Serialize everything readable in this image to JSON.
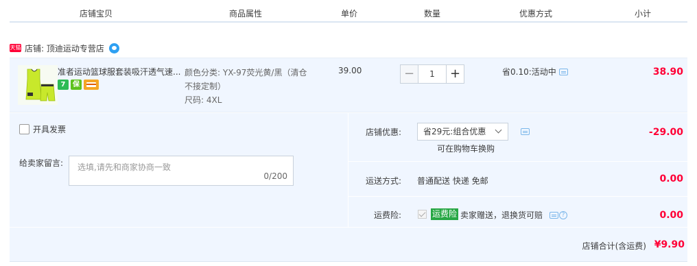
{
  "header": {
    "col_shop_item": "店铺宝贝",
    "col_attributes": "商品属性",
    "col_unit_price": "单价",
    "col_quantity": "数量",
    "col_discount": "优惠方式",
    "col_subtotal": "小计"
  },
  "shop": {
    "badge": "天猫",
    "label": "店铺: 顶迪运动专营店"
  },
  "item": {
    "title": "准者运动篮球服套装吸汗透气速...",
    "service_icons": [
      {
        "name": "7-day-return-icon",
        "text": "7",
        "color": "#2dbb55"
      },
      {
        "name": "guarantee-icon",
        "text": "保",
        "color": "#5dc21e"
      },
      {
        "name": "credit-card-icon",
        "text": "",
        "color": "#f5a623"
      }
    ],
    "attr_color": "颜色分类: YX-97荧光黄/黑（清仓不接定制）",
    "attr_size": "尺码: 4XL",
    "unit_price": "39.00",
    "quantity": "1",
    "qty_minus": "−",
    "qty_plus": "+",
    "promo": "省0.10:活动中",
    "subtotal": "38.90"
  },
  "footer": {
    "invoice_label": "开具发票",
    "message_label": "给卖家留言:",
    "message_placeholder": "选填,请先和商家协商一致",
    "message_count": "0/200",
    "shop_discount_label": "店铺优惠:",
    "shop_discount_value": "省29元:组合优惠",
    "shop_discount_note": "可在购物车换购",
    "shop_discount_amount": "-29.00",
    "shipping_label": "运送方式:",
    "shipping_value": "普通配送 快递 免邮",
    "shipping_amount": "0.00",
    "insurance_label": "运费险:",
    "insurance_tag": "运费险",
    "insurance_text": "卖家赠送，退换货可赔",
    "insurance_amount": "0.00",
    "total_label": "店铺合计(含运费)",
    "total_amount": "¥9.90"
  }
}
